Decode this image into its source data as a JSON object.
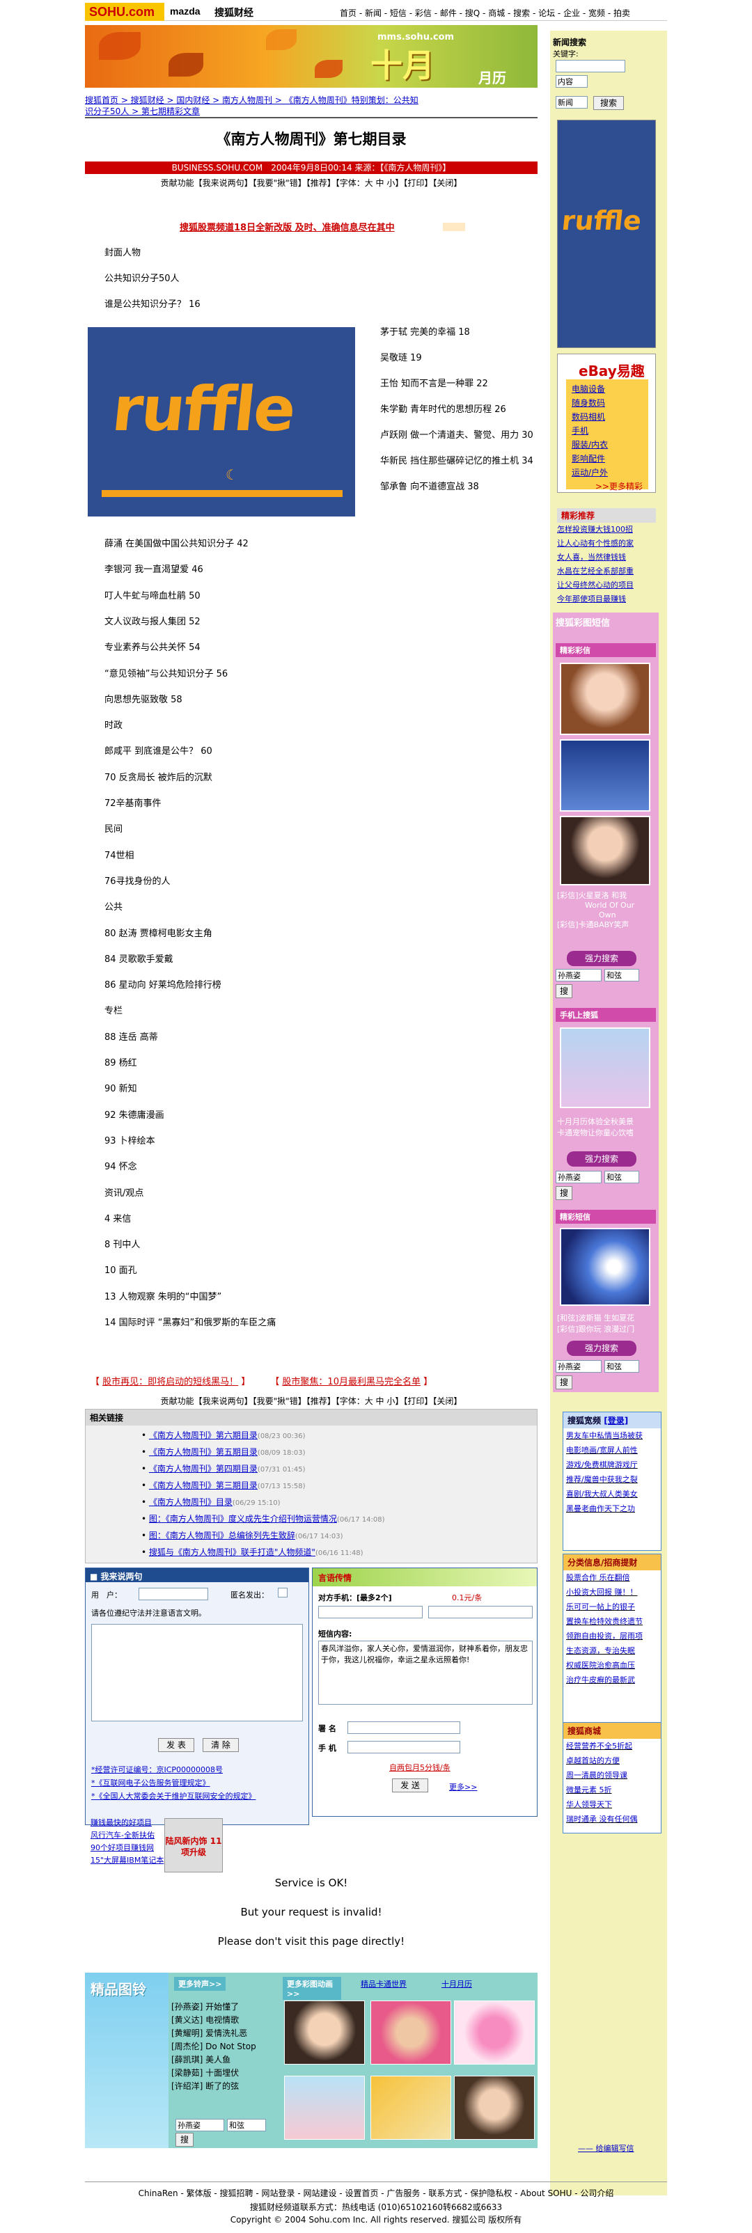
{
  "topbar": {
    "logo": "SOHU.com",
    "brand": "mazda",
    "finance": "搜狐财经",
    "nav": "首页 - 新闻 - 短信 - 彩信 - 邮件 - 搜Q - 商城 - 搜索 - 论坛 - 企业 - 宽频 - 拍卖"
  },
  "banner": {
    "site": "mms.sohu.com",
    "big": "十月",
    "yue": "月历"
  },
  "breadcrumb": {
    "line1": "搜狐首页 > 搜狐财经 > 国内财经 > 南方人物周刊 > 《南方人物周刊》特别策划：公共知",
    "line2": "识分子50人 > 第七期精彩文章"
  },
  "article": {
    "title": "《南方人物周刊》第七期目录",
    "meta": "BUSINESS.SOHU.COM　2004年9月8日00:14 来源：【《南方人物周刊》】",
    "tools": "贡献功能【我来说两句】【我要\"揪\"错】【推荐】【字体：大 中 小】【打印】【关闭】",
    "ad": "搜狐股票频道18日全新改版 及时、准确信息尽在其中",
    "lines_a": [
      "封面人物",
      "公共知识分子50人",
      "谁是公共知识分子？ 16"
    ],
    "lines_b": [
      "茅于轼 完美的幸福 18",
      "吴敬琏 19",
      "王怡 知而不言是一种罪 22",
      "朱学勤 青年时代的思想历程 26",
      "卢跃刚 做一个清道夫、警觉、用力 30",
      "华新民 挡住那些碾碎记忆的推土机 34",
      "邹承鲁 向不道德宣战 38"
    ],
    "lines_c": [
      "薛涌 在美国做中国公共知识分子 42",
      "李银河 我一直渴望爱 46",
      "叮人牛虻与啼血杜鹃 50",
      "文人议政与报人集团 52",
      "专业素养与公共关怀 54",
      "“意见领袖”与公共知识分子 56",
      "向思想先驱致敬 58",
      "时政",
      "郎咸平 到底谁是公牛？ 60",
      "70 反贪局长 被炸后的沉默",
      "72辛基南事件",
      "民间",
      "74世相",
      "76寻找身份的人",
      "公共",
      "80 赵涛 贾樟柯电影女主角",
      "84 灵歌歌手爱戴",
      "86 星动向 好莱坞危险排行榜",
      "专栏",
      "88 连岳 高蒂",
      "89 杨红",
      "90 新知",
      "92 朱德庸漫画",
      "93 卜梓绘本",
      "94 怀念",
      "资讯/观点",
      "4 来信",
      "8 刊中人",
      "10 面孔",
      "13 人物观察 朱明的“中国梦”",
      "14 国际时评 “黑寡妇”和俄罗斯的车臣之痛"
    ]
  },
  "ruffle": {
    "text": "ruffle"
  },
  "bottom_ads": {
    "a": "股市再见：即将启动的短线黑马！",
    "b": "股市聚焦：10月最利黑马完全名单"
  },
  "related": {
    "head": "相关链接",
    "items": [
      {
        "t": "《南方人物周刊》第六期目录",
        "d": "(08/23 00:36)"
      },
      {
        "t": "《南方人物周刊》第五期目录",
        "d": "(08/09 18:03)"
      },
      {
        "t": "《南方人物周刊》第四期目录",
        "d": "(07/31 01:45)"
      },
      {
        "t": "《南方人物周刊》第三期目录",
        "d": "(07/13 15:58)"
      },
      {
        "t": "《南方人物周刊》目录",
        "d": "(06/29 15:10)"
      },
      {
        "t": "图：《南方人物周刊》度义成先生介绍刊物运营情况",
        "d": "(06/17 14:08)"
      },
      {
        "t": "图：《南方人物周刊》总编徐列先生致辞",
        "d": "(06/17 14:03)"
      },
      {
        "t": "搜狐与《南方人物周刊》联手打造\"人物频道\"",
        "d": "(06/16 11:48)"
      }
    ]
  },
  "comment": {
    "head": "■ 我来说两句",
    "user": "用　户：",
    "anon": "匿名发出：",
    "hint": "请各位遵纪守法并注意语言文明。",
    "submit": "发 表",
    "clear": "清 除",
    "links": [
      "*经营许可证编号：京ICP00000008号",
      "*《互联网电子公告服务管理规定》",
      "*《全国人大常委会关于维护互联网安全的规定》"
    ]
  },
  "sms": {
    "head": "言语传情",
    "to": "对方手机：[最多2个]",
    "price": "0.1元/条",
    "content_label": "短信内容:",
    "content": "春风洋溢你，家人关心你，爱情滋润你，财神系着你，朋友忠于你，我这儿祝福你，幸运之星永远照着你!",
    "sign": "署 名",
    "phone": "手 机",
    "monthly": "自两包月5分钱/条",
    "send": "发 送",
    "more": "更多>>"
  },
  "mini_links": [
    "赚钱最快的好项目",
    "风行汽车-全新扶佑",
    "90个好项目赚钱网",
    "15\"大屏幕IBM笔记本"
  ],
  "mini_ad": "陆风新内饰 11项升级",
  "invalid": {
    "l1": "Service is OK!",
    "l2": "But your request is invalid!",
    "l3": "Please don't visit this page directly!"
  },
  "promo": {
    "title": "精品图铃",
    "tab1": "更多铃声>>",
    "tab2": "更多彩图动画>>",
    "tab3": "精品卡通世界",
    "tab4": "十月月历",
    "songs": [
      "[孙燕姿] 开始懂了",
      "[黄义达] 电视情歌",
      "[黄耀明] 爱情洗礼恶",
      "[周杰伦] Do Not Stop",
      "[薛凯琪] 美人鱼",
      "[梁静茹] 十面埋伏",
      "[许绍洋] 断了的弦"
    ],
    "search_value": "孙燕姿",
    "search_opt": "和弦",
    "search_btn": "搜"
  },
  "right": {
    "search_title": "新闻搜索",
    "keyword": "关键字:",
    "opt1": "内容",
    "opt2": "新闻",
    "search_btn": "搜索",
    "ruffle": "ruffle",
    "ebay": "eBay易趣",
    "ebay_items": [
      "电脑设备",
      "随身数码",
      "数码相机",
      "手机",
      "服装/内衣",
      "影响配件",
      "运动/户外"
    ],
    "ebay_more": ">>更多精彩",
    "jc_head": "精彩推荐",
    "jc_items": [
      "怎样投资赚大钱100招",
      "让人心动有个性感的家",
      "女人喜，当然律钱钱",
      "水昌在艺经全系部部重",
      "让父母终然心动的项目",
      "今年那使项目最赚钱"
    ],
    "duanxin": "搜狐彩图短信",
    "caixin": "精彩彩信",
    "cap1": "[彩信]火星夏洛 和我",
    "cap2": "World Of Our",
    "cap3": "Own",
    "cap4": "[彩信]卡通BABY笑声",
    "qiang": "强力搜索",
    "phone_head": "手机上搜狐",
    "cap5": "十月月历体验全秋美景",
    "cap6": "卡通宠物让你童心饮嗜",
    "jc2": "精彩短信",
    "cap7": "[和弦]波斯猫 生如夏花",
    "cap8": "[彩信]跟你玩 浪漫过门",
    "sv": "孙燕姿",
    "so": "和弦",
    "sb": "搜",
    "kb_head": "搜狐宽频",
    "kb_login": "[登录]",
    "kb_items": [
      "男友车中私情当场被获",
      "电影喷画/宽屏人前性",
      "游戏/免费棋牌游戏厅",
      "推荐/魔兽中获我之裂",
      "喜剧/我大叔人类美女",
      "黑曼老曲作天下之功"
    ],
    "fl_head": "分类信息/招商提财",
    "fl_items": [
      "股票合作 乐在翻倍",
      "小投资大回报 赚！！",
      "乐可可一帖上的银子",
      "置换车检特效贵终遗节",
      "领跑自由投资，层雨项",
      "生态资源，专治失眠",
      "权威医院治愈高血压",
      "治疗牛皮癣的最新武"
    ],
    "sc_head": "搜狐商城",
    "sc_items": [
      "经营营养不全5折起",
      "卓越首站的方便",
      "周一清晨的领导课",
      "微量元素 5折",
      "华人领导天下",
      "瑞时通承 没有任何偶"
    ],
    "report": "—— 给编辑写信"
  },
  "footer": {
    "links": "ChinaRen - 繁体版 - 搜狐招聘 - 网站登录 - 网站建设 - 设置首页 - 广告服务 - 联系方式 - 保护隐私权 - About SOHU - 公司介绍",
    "phone": "搜狐财经频道联系方式：热线电话 (010)65102160转6682或6633",
    "copy": "Copyright © 2004 Sohu.com Inc. All rights reserved. 搜狐公司 版权所有"
  }
}
